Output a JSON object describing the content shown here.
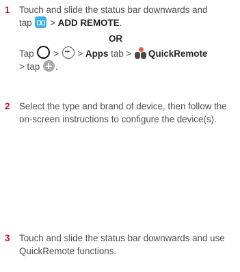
{
  "colors": {
    "step_number": "#c8102e",
    "text": "#4d4d4d",
    "emphasis": "#222222",
    "quickremote_icon": "#3fb3e6",
    "add_icon": "#a9a9b0"
  },
  "icons": {
    "quickremote_notification": "quickremote-icon",
    "home": "home-icon",
    "apps_drawer": "apps-icon",
    "quickremote_app": "quickremote-app-icon",
    "add": "add-icon"
  },
  "steps": [
    {
      "number": "1",
      "line1": "Touch and slide the status bar downwards and",
      "line2_pre": "tap",
      "line2_sep": ">",
      "line2_bold": "ADD REMOTE",
      "line2_post": ".",
      "or": "OR",
      "line4_pre": "Tap",
      "line4_sep1": ">",
      "line4_sep2": ">",
      "line4_apps": "Apps",
      "line4_tab": "tab >",
      "line4_app": "QuickRemote",
      "line5_pre": "> tap",
      "line5_post": "."
    },
    {
      "number": "2",
      "line1": "Select the type and brand of device, then follow the",
      "line2": "on-screen instructions to configure the device(s)."
    },
    {
      "number": "3",
      "line1": "Touch and slide the status bar downwards and use",
      "line2": "QuickRemote functions."
    }
  ]
}
